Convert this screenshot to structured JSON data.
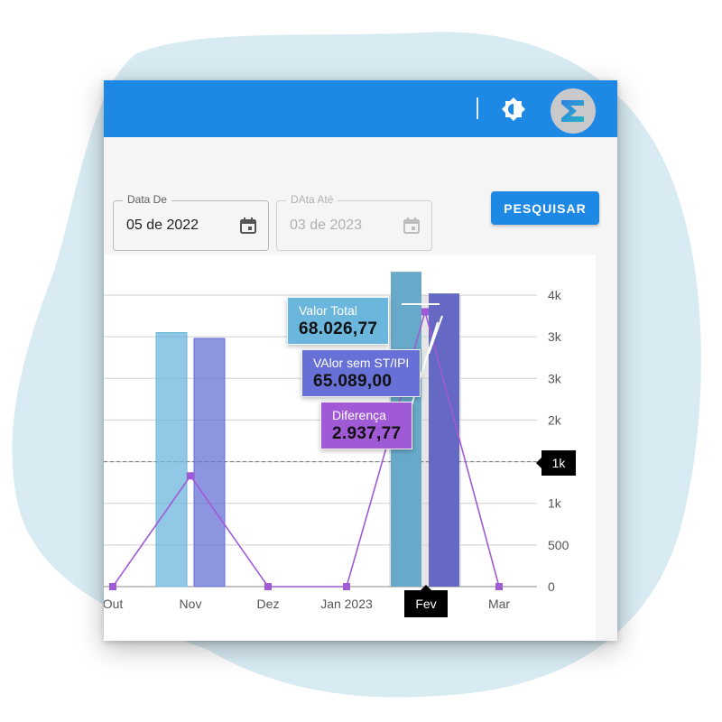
{
  "header": {
    "theme_toggle_icon": "brightness-icon",
    "avatar_icon": "sigma-logo-icon"
  },
  "filters": {
    "date_from": {
      "label": "Data De",
      "value": "05 de 2022",
      "icon": "calendar-icon"
    },
    "date_to": {
      "label": "DAta Até",
      "value": "03 de 2023",
      "icon": "calendar-icon",
      "disabled": true
    },
    "search_button": "PESQUISAR"
  },
  "colors": {
    "primary": "#1e88e5",
    "valor_total": "#6bb6dc",
    "valor_sem_st": "#6770d6",
    "diferenca": "#a05ad6"
  },
  "chart_data": {
    "type": "bar",
    "categories": [
      "Out",
      "Nov",
      "Dez",
      "Jan 2023",
      "Fev",
      "Mar"
    ],
    "series": [
      {
        "name": "Valor Total",
        "type": "bar",
        "values": [
          0,
          3050,
          0,
          0,
          3780,
          0
        ]
      },
      {
        "name": "VAlor sem ST/IPI",
        "type": "bar",
        "values": [
          0,
          2980,
          0,
          0,
          3520,
          0
        ]
      },
      {
        "name": "Diferença",
        "type": "line",
        "values": [
          0,
          1330,
          0,
          0,
          3300,
          0
        ]
      }
    ],
    "y_ticks": [
      "0",
      "500",
      "1k",
      "1k",
      "2k",
      "3k",
      "3k",
      "4k"
    ],
    "ylim": [
      0,
      3500
    ],
    "reference_line": {
      "value": 1500,
      "label": "1k"
    },
    "highlighted_category": "Fev",
    "tooltip": [
      {
        "label": "Valor Total",
        "value": "68.026,77"
      },
      {
        "label": "VAlor sem ST/IPI",
        "value": "65.089,00"
      },
      {
        "label": "Diferença",
        "value": "2.937,77"
      }
    ]
  }
}
